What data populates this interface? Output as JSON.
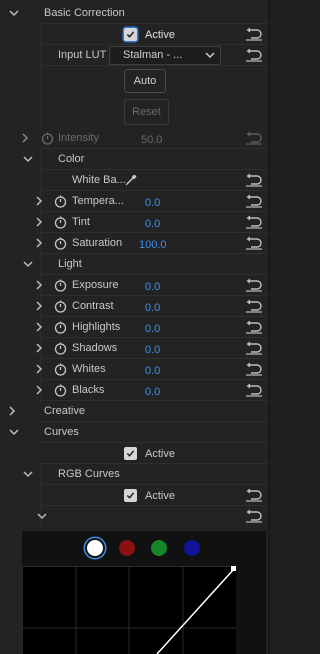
{
  "basic_correction": {
    "title": "Basic Correction",
    "active_label": "Active",
    "input_lut_label": "Input LUT",
    "input_lut_value": "Stalman - ...",
    "auto_label": "Auto",
    "reset_label": "Reset",
    "intensity_label": "Intensity",
    "intensity_value": "50.0",
    "color": {
      "title": "Color",
      "white_balance_label": "White Ba...",
      "rows": [
        {
          "label": "Tempera...",
          "value": "0.0"
        },
        {
          "label": "Tint",
          "value": "0.0"
        },
        {
          "label": "Saturation",
          "value": "100.0"
        }
      ]
    },
    "light": {
      "title": "Light",
      "rows": [
        {
          "label": "Exposure",
          "value": "0.0"
        },
        {
          "label": "Contrast",
          "value": "0.0"
        },
        {
          "label": "Highlights",
          "value": "0.0"
        },
        {
          "label": "Shadows",
          "value": "0.0"
        },
        {
          "label": "Whites",
          "value": "0.0"
        },
        {
          "label": "Blacks",
          "value": "0.0"
        }
      ]
    }
  },
  "creative": {
    "title": "Creative"
  },
  "curves": {
    "title": "Curves",
    "active_label": "Active",
    "rgb_curves": {
      "title": "RGB Curves",
      "active_label": "Active",
      "channels": [
        {
          "name": "white",
          "color": "#ffffff"
        },
        {
          "name": "red",
          "color": "#8b1010"
        },
        {
          "name": "green",
          "color": "#15872a"
        },
        {
          "name": "blue",
          "color": "#13139a"
        }
      ]
    }
  },
  "colors": {
    "accent": "#3f8fe6",
    "panel": "#232323"
  }
}
